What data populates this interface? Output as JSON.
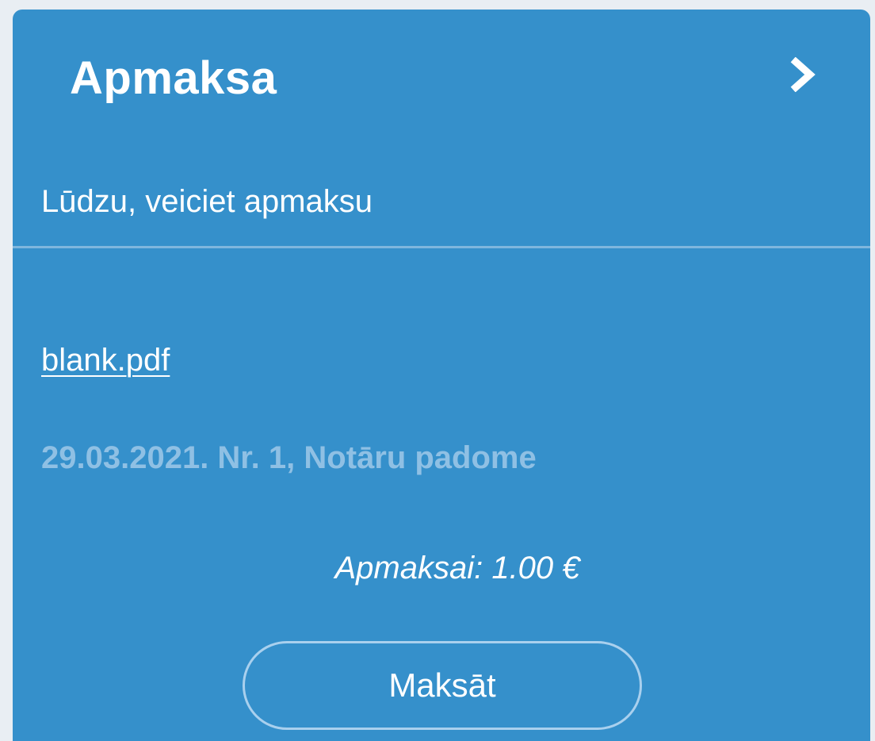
{
  "card": {
    "title": "Apmaksa",
    "next_icon": "chevron-right-icon",
    "subtitle": "Lūdzu, veiciet apmaksu",
    "file_link": "blank.pdf",
    "meta": "29.03.2021. Nr. 1, Notāru padome",
    "amount": "Apmaksai: 1.00 €",
    "pay_button": "Maksāt"
  },
  "colors": {
    "card_background": "#3590cb",
    "page_background": "#e9eef3",
    "muted_text": "#8fc0e4",
    "divider": "#7fb6dd",
    "button_border": "#a9d0ee"
  }
}
